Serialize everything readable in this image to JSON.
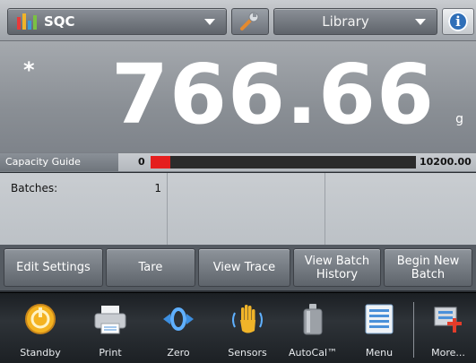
{
  "topbar": {
    "app_name": "SQC",
    "library_label": "Library",
    "info_glyph": "i",
    "app_icon_colors": [
      "#e63b3b",
      "#f0b429",
      "#3d9bd6",
      "#7ac143"
    ]
  },
  "display": {
    "stable_indicator": "*",
    "weight": "766.66",
    "unit": "g"
  },
  "capacity_guide": {
    "label": "Capacity Guide",
    "min": "0",
    "max": "10200.00",
    "fill_fraction": 0.075,
    "fill_color": "#e51e1e"
  },
  "data_area": {
    "batches_label": "Batches:",
    "batches_value": "1"
  },
  "softkeys": [
    {
      "label": "Edit Settings"
    },
    {
      "label": "Tare"
    },
    {
      "label": "View Trace"
    },
    {
      "label": "View Batch History"
    },
    {
      "label": "Begin New Batch"
    }
  ],
  "toolbar": {
    "standby": "Standby",
    "print": "Print",
    "zero": "Zero",
    "sensors": "Sensors",
    "autocal": "AutoCal™",
    "menu": "Menu",
    "more": "More..."
  }
}
